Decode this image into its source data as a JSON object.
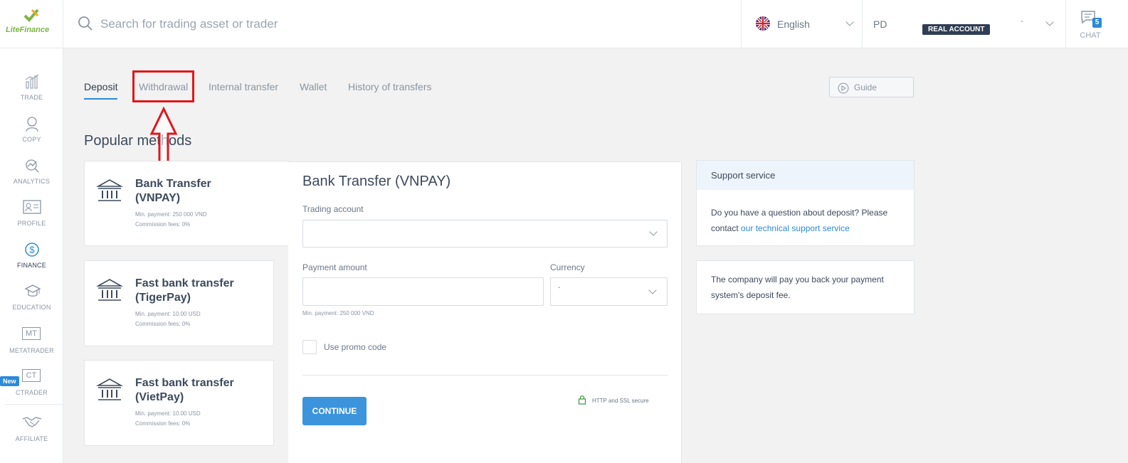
{
  "header": {
    "logo_text": "LiteFinance",
    "search_placeholder": "Search for trading asset or trader",
    "language": "English",
    "account_initials": "PD",
    "account_type": "REAL ACCOUNT",
    "account_dash": "-",
    "chat_label": "CHAT",
    "chat_count": "5"
  },
  "sidebar": {
    "items": [
      {
        "label": "TRADE",
        "icon": "chart-icon"
      },
      {
        "label": "COPY",
        "icon": "trader-icon"
      },
      {
        "label": "ANALYTICS",
        "icon": "analytics-icon"
      },
      {
        "label": "PROFILE",
        "icon": "profile-card-icon"
      },
      {
        "label": "FINANCE",
        "icon": "dollar-icon",
        "active": true
      },
      {
        "label": "EDUCATION",
        "icon": "graduation-cap-icon"
      },
      {
        "label": "METATRADER",
        "icon_text": "MT"
      },
      {
        "label": "CTRADER",
        "icon_text": "CT",
        "badge": "New"
      },
      {
        "label": "AFFILIATE",
        "icon": "handshake-icon"
      }
    ]
  },
  "tabs": [
    {
      "label": "Deposit",
      "active": true
    },
    {
      "label": "Withdrawal"
    },
    {
      "label": "Internal transfer"
    },
    {
      "label": "Wallet"
    },
    {
      "label": "History of transfers"
    }
  ],
  "guide_label": "Guide",
  "section_title": "Popular methods",
  "methods": [
    {
      "name_line1": "Bank Transfer",
      "name_line2": "(VNPAY)",
      "min": "Min. payment: 250 000 VND",
      "fee": "Commission fees: 0%"
    },
    {
      "name_line1": "Fast bank transfer",
      "name_line2": "(TigerPay)",
      "min": "Min. payment: 10.00 USD",
      "fee": "Commission fees: 0%"
    },
    {
      "name_line1": "Fast bank transfer",
      "name_line2": "(VietPay)",
      "min": "Min. payment: 10.00 USD",
      "fee": "Commission fees: 0%"
    }
  ],
  "form": {
    "title": "Bank Transfer (VNPAY)",
    "trading_account_label": "Trading account",
    "payment_amount_label": "Payment amount",
    "currency_label": "Currency",
    "currency_value": "-",
    "min_hint": "Min. payment: 250 000 VND",
    "promo_label": "Use promo code",
    "continue_label": "CONTINUE",
    "secure_label": "HTTP and SSL secure"
  },
  "support": {
    "title": "Support service",
    "text": "Do you have a question about deposit? Please contact ",
    "link": "our technical support service"
  },
  "refund_text": "The company will pay you back your payment system's deposit fee."
}
